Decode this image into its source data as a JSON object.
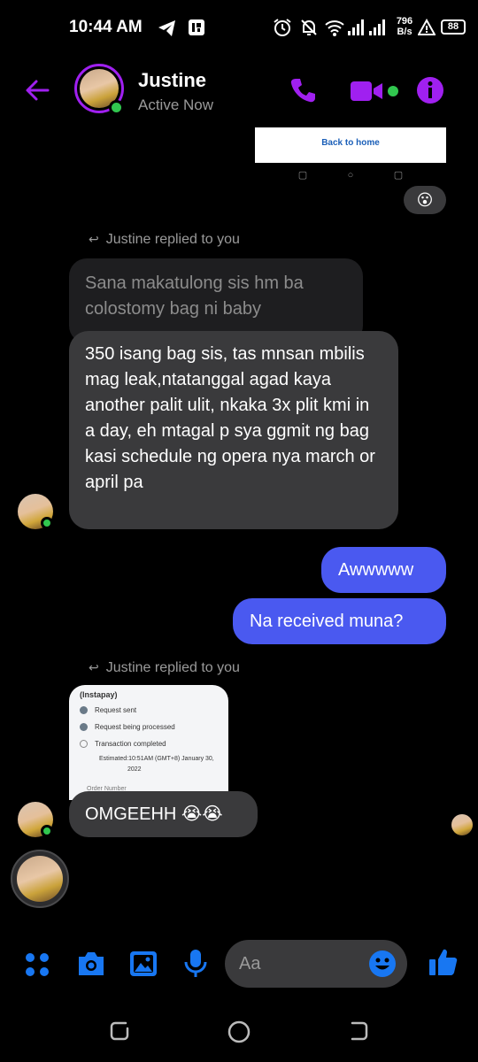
{
  "status_bar": {
    "time": "10:44 AM",
    "net_speed_value": "796",
    "net_speed_unit": "B/s",
    "battery": "88",
    "icons": [
      "telegram-icon",
      "app-icon",
      "alarm-icon",
      "mute-icon",
      "wifi-icon",
      "signal-icon",
      "hotspot-icon",
      "battery-icon"
    ]
  },
  "header": {
    "name": "Justine",
    "status": "Active Now",
    "accent": "#a020f0",
    "icons": [
      "back-arrow-icon",
      "phone-icon",
      "video-icon",
      "info-icon"
    ]
  },
  "shared_image": {
    "banner_text": "Back to home"
  },
  "reaction": {
    "emoji": "😮"
  },
  "messages": {
    "reply_label_1": "Justine replied to you",
    "quoted_text": "Sana makatulong sis hm ba colostomy bag ni baby",
    "incoming_1": "350 isang bag sis, tas mnsan mbilis mag leak,ntatanggal agad kaya another palit ulit, nkaka 3x plit kmi in a day, eh mtagal p sya ggmit ng bag kasi schedule ng opera nya  march or april pa",
    "outgoing_1": "Awwwww",
    "outgoing_2": "Na received muna?",
    "reply_label_2": "Justine replied to you",
    "image_reply": {
      "title": "(Instapay)",
      "step1": "Request sent",
      "step2": "Request being processed",
      "step3": "Transaction completed",
      "estimated_1": "Estimated:10:51AM (GMT+8) January 30,",
      "estimated_2": "2022",
      "order_number": "Order Number"
    },
    "incoming_2": "OMGEEHH 😭😭"
  },
  "composer": {
    "placeholder": "Aa",
    "accent": "#1877f2",
    "icons": [
      "menu-dots-icon",
      "camera-icon",
      "gallery-icon",
      "microphone-icon",
      "emoji-icon",
      "like-icon"
    ]
  },
  "colors": {
    "outgoing_bubble": "#4a59f0",
    "incoming_bubble": "#3a3a3c",
    "online": "#31c74f"
  }
}
